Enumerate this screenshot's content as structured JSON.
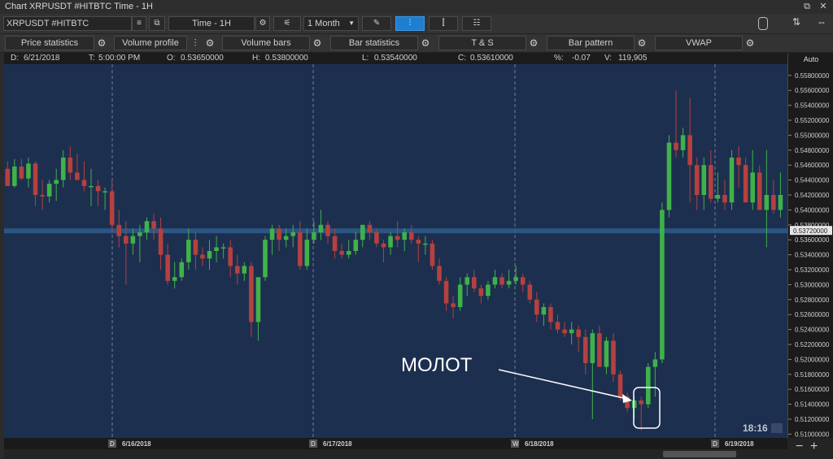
{
  "window": {
    "title": "Chart XRPUSDT  #HITBTC Time - 1H",
    "controls": [
      "⧉",
      "✕"
    ]
  },
  "toolbar": {
    "symbol": "XRPUSDT  #HITBTC",
    "timeframe": "Time - 1H",
    "period": "1 Month",
    "draw_label": "✎",
    "tool_icons": [
      "≡",
      "⧉",
      "⚙",
      "⚟",
      "✎",
      "⫶",
      "⫿",
      "☷"
    ]
  },
  "indicators": [
    {
      "label": "Price statistics"
    },
    {
      "label": "Volume profile"
    },
    {
      "label": "Volume bars"
    },
    {
      "label": "Bar statistics"
    },
    {
      "label": "T & S"
    },
    {
      "label": "Bar pattern"
    },
    {
      "label": "VWAP"
    }
  ],
  "info": {
    "d_label": "D:",
    "d": "6/21/2018",
    "t_label": "T:",
    "t": "5:00:00 PM",
    "o_label": "O:",
    "o": "0.53650000",
    "h_label": "H:",
    "h": "0.53800000",
    "l_label": "L:",
    "l": "0.53540000",
    "c_label": "C:",
    "c": "0.53610000",
    "pct_label": "%:",
    "pct": "-0.07",
    "v_label": "V:",
    "v": "119,905"
  },
  "yaxis": {
    "mode": "Auto",
    "current_price": "0.53720000",
    "ticks": [
      "0.55800000",
      "0.55600000",
      "0.55400000",
      "0.55200000",
      "0.55000000",
      "0.54800000",
      "0.54600000",
      "0.54400000",
      "0.54200000",
      "0.54000000",
      "0.53800000",
      "0.53600000",
      "0.53400000",
      "0.53200000",
      "0.53000000",
      "0.52800000",
      "0.52600000",
      "0.52400000",
      "0.52200000",
      "0.52000000",
      "0.51800000",
      "0.51600000",
      "0.51400000",
      "0.51200000",
      "0.51000000"
    ]
  },
  "xaxis": {
    "dates": [
      {
        "marker": "D",
        "label": "6/16/2018"
      },
      {
        "marker": "D",
        "label": "6/17/2018"
      },
      {
        "marker": "W",
        "label": "6/18/2018"
      },
      {
        "marker": "D",
        "label": "6/19/2018"
      }
    ]
  },
  "annotation": {
    "text": "МОЛОТ"
  },
  "clock": "18:16",
  "zoom": {
    "minus": "−",
    "plus": "+"
  },
  "colors": {
    "bg": "#1d2f4f",
    "up": "#3fb24a",
    "down": "#b5413e",
    "accent": "#1e7fd0"
  },
  "chart_data": {
    "type": "candlestick",
    "ylim": [
      0.5095,
      0.5595
    ],
    "candles": [
      [
        0.5455,
        0.5465,
        0.5432,
        0.5432
      ],
      [
        0.5432,
        0.5468,
        0.543,
        0.5458
      ],
      [
        0.5458,
        0.5468,
        0.544,
        0.5442
      ],
      [
        0.5442,
        0.547,
        0.543,
        0.5462
      ],
      [
        0.5462,
        0.5465,
        0.5405,
        0.542
      ],
      [
        0.542,
        0.544,
        0.54,
        0.5418
      ],
      [
        0.5418,
        0.544,
        0.541,
        0.5435
      ],
      [
        0.5435,
        0.5455,
        0.5412,
        0.544
      ],
      [
        0.544,
        0.548,
        0.543,
        0.547
      ],
      [
        0.547,
        0.5485,
        0.544,
        0.545
      ],
      [
        0.545,
        0.5475,
        0.544,
        0.544
      ],
      [
        0.544,
        0.5465,
        0.5425,
        0.5432
      ],
      [
        0.5432,
        0.5455,
        0.5405,
        0.5432
      ],
      [
        0.5432,
        0.544,
        0.5405,
        0.5425
      ],
      [
        0.5425,
        0.543,
        0.54,
        0.5425
      ],
      [
        0.5425,
        0.544,
        0.537,
        0.538
      ],
      [
        0.538,
        0.54,
        0.535,
        0.5365
      ],
      [
        0.5365,
        0.5385,
        0.53,
        0.5355
      ],
      [
        0.5355,
        0.5375,
        0.534,
        0.5365
      ],
      [
        0.5365,
        0.538,
        0.533,
        0.537
      ],
      [
        0.537,
        0.539,
        0.536,
        0.5385
      ],
      [
        0.5385,
        0.5395,
        0.536,
        0.5375
      ],
      [
        0.5375,
        0.539,
        0.532,
        0.534
      ],
      [
        0.534,
        0.5355,
        0.53,
        0.5305
      ],
      [
        0.5305,
        0.533,
        0.5295,
        0.531
      ],
      [
        0.531,
        0.5335,
        0.5305,
        0.533
      ],
      [
        0.533,
        0.5375,
        0.532,
        0.536
      ],
      [
        0.536,
        0.537,
        0.532,
        0.534
      ],
      [
        0.534,
        0.535,
        0.5325,
        0.5335
      ],
      [
        0.5335,
        0.536,
        0.532,
        0.5345
      ],
      [
        0.5345,
        0.5365,
        0.533,
        0.535
      ],
      [
        0.535,
        0.5355,
        0.5335,
        0.535
      ],
      [
        0.535,
        0.536,
        0.531,
        0.5325
      ],
      [
        0.5325,
        0.534,
        0.53,
        0.5315
      ],
      [
        0.5315,
        0.533,
        0.5305,
        0.5325
      ],
      [
        0.5325,
        0.533,
        0.523,
        0.525
      ],
      [
        0.525,
        0.53,
        0.5225,
        0.531
      ],
      [
        0.531,
        0.5365,
        0.5305,
        0.536
      ],
      [
        0.536,
        0.538,
        0.534,
        0.5375
      ],
      [
        0.5375,
        0.538,
        0.5345,
        0.536
      ],
      [
        0.536,
        0.5375,
        0.535,
        0.5365
      ],
      [
        0.5365,
        0.538,
        0.535,
        0.537
      ],
      [
        0.537,
        0.5385,
        0.532,
        0.5325
      ],
      [
        0.5325,
        0.5375,
        0.532,
        0.536
      ],
      [
        0.536,
        0.5385,
        0.5355,
        0.537
      ],
      [
        0.537,
        0.54,
        0.536,
        0.538
      ],
      [
        0.538,
        0.5385,
        0.5355,
        0.5365
      ],
      [
        0.5365,
        0.5375,
        0.5335,
        0.5345
      ],
      [
        0.5345,
        0.5355,
        0.5335,
        0.534
      ],
      [
        0.534,
        0.536,
        0.5335,
        0.5345
      ],
      [
        0.5345,
        0.537,
        0.534,
        0.536
      ],
      [
        0.536,
        0.538,
        0.535,
        0.538
      ],
      [
        0.538,
        0.5385,
        0.536,
        0.537
      ],
      [
        0.537,
        0.5375,
        0.535,
        0.5355
      ],
      [
        0.5355,
        0.536,
        0.533,
        0.535
      ],
      [
        0.535,
        0.537,
        0.534,
        0.5365
      ],
      [
        0.5365,
        0.5385,
        0.535,
        0.536
      ],
      [
        0.536,
        0.5375,
        0.5345,
        0.537
      ],
      [
        0.537,
        0.538,
        0.5355,
        0.536
      ],
      [
        0.536,
        0.5365,
        0.533,
        0.5355
      ],
      [
        0.5355,
        0.5365,
        0.534,
        0.5355
      ],
      [
        0.5355,
        0.536,
        0.532,
        0.5325
      ],
      [
        0.5325,
        0.5335,
        0.53,
        0.5305
      ],
      [
        0.5305,
        0.531,
        0.5265,
        0.5275
      ],
      [
        0.5275,
        0.5285,
        0.5255,
        0.527
      ],
      [
        0.527,
        0.531,
        0.5265,
        0.53
      ],
      [
        0.53,
        0.5315,
        0.5285,
        0.531
      ],
      [
        0.531,
        0.532,
        0.529,
        0.5295
      ],
      [
        0.5295,
        0.53,
        0.5275,
        0.5285
      ],
      [
        0.5285,
        0.5305,
        0.528,
        0.53
      ],
      [
        0.53,
        0.532,
        0.5295,
        0.531
      ],
      [
        0.531,
        0.5315,
        0.5295,
        0.53
      ],
      [
        0.53,
        0.532,
        0.5295,
        0.5305
      ],
      [
        0.5305,
        0.5325,
        0.53,
        0.531
      ],
      [
        0.531,
        0.5315,
        0.529,
        0.53
      ],
      [
        0.53,
        0.5305,
        0.5275,
        0.528
      ],
      [
        0.528,
        0.529,
        0.525,
        0.526
      ],
      [
        0.526,
        0.5275,
        0.5245,
        0.527
      ],
      [
        0.527,
        0.5275,
        0.524,
        0.525
      ],
      [
        0.525,
        0.526,
        0.5235,
        0.524
      ],
      [
        0.524,
        0.525,
        0.523,
        0.5235
      ],
      [
        0.5235,
        0.525,
        0.522,
        0.524
      ],
      [
        0.524,
        0.5245,
        0.521,
        0.523
      ],
      [
        0.523,
        0.524,
        0.518,
        0.5195
      ],
      [
        0.5195,
        0.524,
        0.512,
        0.5235
      ],
      [
        0.5235,
        0.5245,
        0.519,
        0.519
      ],
      [
        0.519,
        0.523,
        0.518,
        0.5225
      ],
      [
        0.5225,
        0.5235,
        0.517,
        0.518
      ],
      [
        0.518,
        0.5185,
        0.5145,
        0.515
      ],
      [
        0.515,
        0.5155,
        0.513,
        0.5135
      ],
      [
        0.5135,
        0.515,
        0.512,
        0.5145
      ],
      [
        0.5145,
        0.515,
        0.5105,
        0.514
      ],
      [
        0.514,
        0.5195,
        0.5135,
        0.519
      ],
      [
        0.519,
        0.521,
        0.515,
        0.52
      ],
      [
        0.52,
        0.541,
        0.5195,
        0.54
      ],
      [
        0.54,
        0.55,
        0.539,
        0.549
      ],
      [
        0.549,
        0.556,
        0.547,
        0.548
      ],
      [
        0.548,
        0.551,
        0.547,
        0.55
      ],
      [
        0.55,
        0.555,
        0.541,
        0.546
      ],
      [
        0.546,
        0.547,
        0.54,
        0.542
      ],
      [
        0.542,
        0.547,
        0.54,
        0.546
      ],
      [
        0.546,
        0.548,
        0.541,
        0.5415
      ],
      [
        0.5415,
        0.545,
        0.541,
        0.542
      ],
      [
        0.542,
        0.544,
        0.54,
        0.541
      ],
      [
        0.541,
        0.548,
        0.54,
        0.547
      ],
      [
        0.547,
        0.5485,
        0.543,
        0.546
      ],
      [
        0.546,
        0.547,
        0.542,
        0.541
      ],
      [
        0.541,
        0.548,
        0.54,
        0.545
      ],
      [
        0.545,
        0.546,
        0.54,
        0.54
      ],
      [
        0.54,
        0.548,
        0.535,
        0.542
      ],
      [
        0.542,
        0.544,
        0.5395,
        0.54
      ],
      [
        0.54,
        0.545,
        0.539,
        0.542
      ]
    ],
    "current_price": 0.5372
  }
}
